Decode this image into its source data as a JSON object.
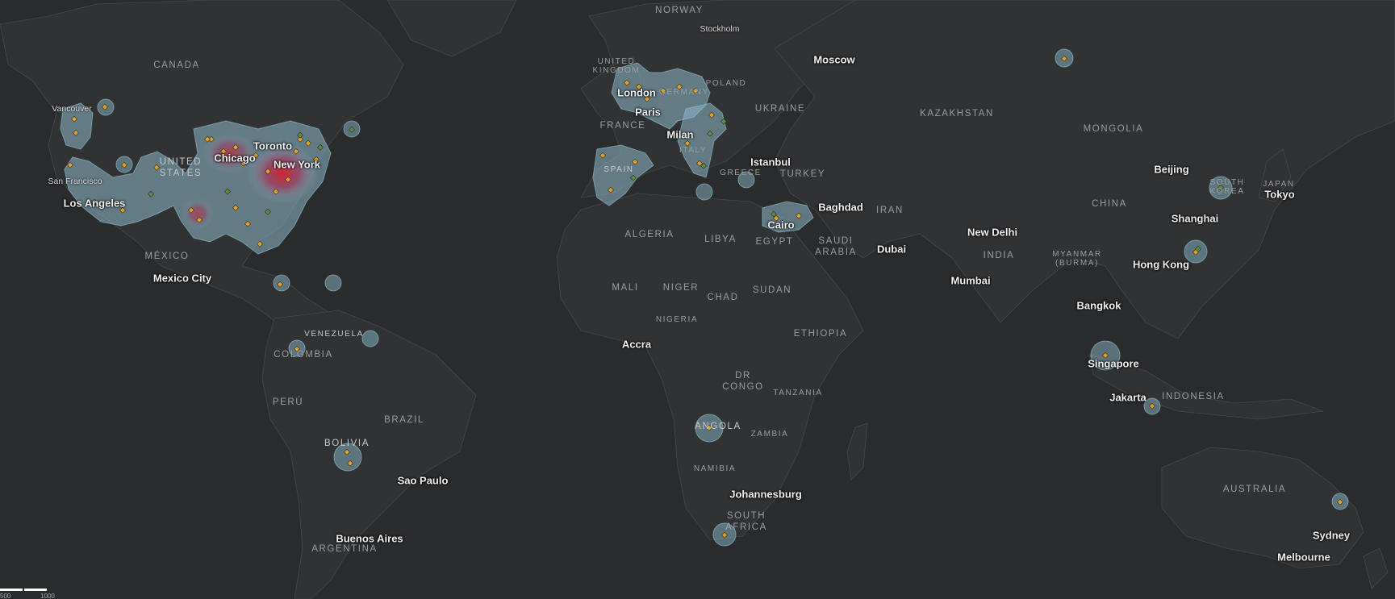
{
  "map": {
    "country_labels": [
      {
        "id": "canada",
        "text": "CANADA"
      },
      {
        "id": "united-states",
        "text": "UNITED\nSTATES"
      },
      {
        "id": "mexico",
        "text": "MÉXICO"
      },
      {
        "id": "venezuela",
        "text": "VENEZUELA"
      },
      {
        "id": "colombia",
        "text": "COLOMBIA"
      },
      {
        "id": "peru",
        "text": "PERÚ"
      },
      {
        "id": "brazil",
        "text": "BRAZIL"
      },
      {
        "id": "bolivia",
        "text": "BOLIVIA"
      },
      {
        "id": "argentina",
        "text": "ARGENTINA"
      },
      {
        "id": "norway",
        "text": "NORWAY"
      },
      {
        "id": "united-kingdom",
        "text": "UNITED\nKINGDOM"
      },
      {
        "id": "germany",
        "text": "GERMANY"
      },
      {
        "id": "poland",
        "text": "POLAND"
      },
      {
        "id": "france",
        "text": "FRANCE"
      },
      {
        "id": "ukraine",
        "text": "UKRAINE"
      },
      {
        "id": "italy",
        "text": "ITALY"
      },
      {
        "id": "spain",
        "text": "SPAIN"
      },
      {
        "id": "greece",
        "text": "GREECE"
      },
      {
        "id": "turkey",
        "text": "TURKEY"
      },
      {
        "id": "kazakhstan",
        "text": "KAZAKHSTAN"
      },
      {
        "id": "mongolia",
        "text": "MONGOLIA"
      },
      {
        "id": "china",
        "text": "CHINA"
      },
      {
        "id": "south-korea",
        "text": "SOUTH\nKOREA"
      },
      {
        "id": "japan",
        "text": "JAPAN"
      },
      {
        "id": "iran",
        "text": "IRAN"
      },
      {
        "id": "saudi-arabia",
        "text": "SAUDI\nARABIA"
      },
      {
        "id": "india",
        "text": "INDIA"
      },
      {
        "id": "myanmar",
        "text": "MYANMAR\n(BURMA)"
      },
      {
        "id": "algeria",
        "text": "ALGERIA"
      },
      {
        "id": "libya",
        "text": "LIBYA"
      },
      {
        "id": "egypt",
        "text": "EGYPT"
      },
      {
        "id": "mali",
        "text": "MALI"
      },
      {
        "id": "niger",
        "text": "NIGER"
      },
      {
        "id": "chad",
        "text": "CHAD"
      },
      {
        "id": "sudan",
        "text": "SUDAN"
      },
      {
        "id": "nigeria",
        "text": "NIGERIA"
      },
      {
        "id": "ethiopia",
        "text": "ETHIOPIA"
      },
      {
        "id": "dr-congo",
        "text": "DR\nCONGO"
      },
      {
        "id": "tanzania",
        "text": "TANZANIA"
      },
      {
        "id": "angola",
        "text": "ANGOLA"
      },
      {
        "id": "zambia",
        "text": "ZAMBIA"
      },
      {
        "id": "namibia",
        "text": "NAMIBIA"
      },
      {
        "id": "south-africa",
        "text": "SOUTH\nAFRICA"
      },
      {
        "id": "indonesia",
        "text": "INDONESIA"
      },
      {
        "id": "australia",
        "text": "AUSTRALIA"
      }
    ],
    "city_labels": [
      {
        "id": "vancouver",
        "text": "Vancouver",
        "small": true
      },
      {
        "id": "san-francisco",
        "text": "San Francisco",
        "small": true
      },
      {
        "id": "los-angeles",
        "text": "Los Angeles"
      },
      {
        "id": "chicago",
        "text": "Chicago"
      },
      {
        "id": "toronto",
        "text": "Toronto"
      },
      {
        "id": "new-york",
        "text": "New York"
      },
      {
        "id": "mexico-city",
        "text": "Mexico City"
      },
      {
        "id": "sao-paulo",
        "text": "Sao Paulo"
      },
      {
        "id": "buenos-aires",
        "text": "Buenos Aires"
      },
      {
        "id": "stockholm",
        "text": "Stockholm",
        "small": true
      },
      {
        "id": "moscow",
        "text": "Moscow"
      },
      {
        "id": "london",
        "text": "London"
      },
      {
        "id": "paris",
        "text": "Paris"
      },
      {
        "id": "milan",
        "text": "Milan"
      },
      {
        "id": "istanbul",
        "text": "Istanbul"
      },
      {
        "id": "baghdad",
        "text": "Baghdad"
      },
      {
        "id": "cairo",
        "text": "Cairo"
      },
      {
        "id": "dubai",
        "text": "Dubai"
      },
      {
        "id": "new-delhi",
        "text": "New Delhi"
      },
      {
        "id": "mumbai",
        "text": "Mumbai"
      },
      {
        "id": "beijing",
        "text": "Beijing"
      },
      {
        "id": "tokyo",
        "text": "Tokyo"
      },
      {
        "id": "shanghai",
        "text": "Shanghai"
      },
      {
        "id": "hong-kong",
        "text": "Hong Kong"
      },
      {
        "id": "bangkok",
        "text": "Bangkok"
      },
      {
        "id": "singapore",
        "text": "Singapore"
      },
      {
        "id": "jakarta",
        "text": "Jakarta"
      },
      {
        "id": "accra",
        "text": "Accra"
      },
      {
        "id": "johannesburg",
        "text": "Johannesburg"
      },
      {
        "id": "sydney",
        "text": "Sydney"
      },
      {
        "id": "melbourne",
        "text": "Melbourne"
      }
    ],
    "colors": {
      "background": "#2a2b2d",
      "land": "#303133",
      "border": "#444549",
      "heat_low": "#8ab8c8",
      "heat_mid": "#b06a8e",
      "heat_high": "#d8302e",
      "marker_orange": "#e0a127",
      "marker_green": "#5d8c3a"
    },
    "scale_bar": {
      "left_label": "500",
      "right_label": "1000 mi"
    }
  }
}
